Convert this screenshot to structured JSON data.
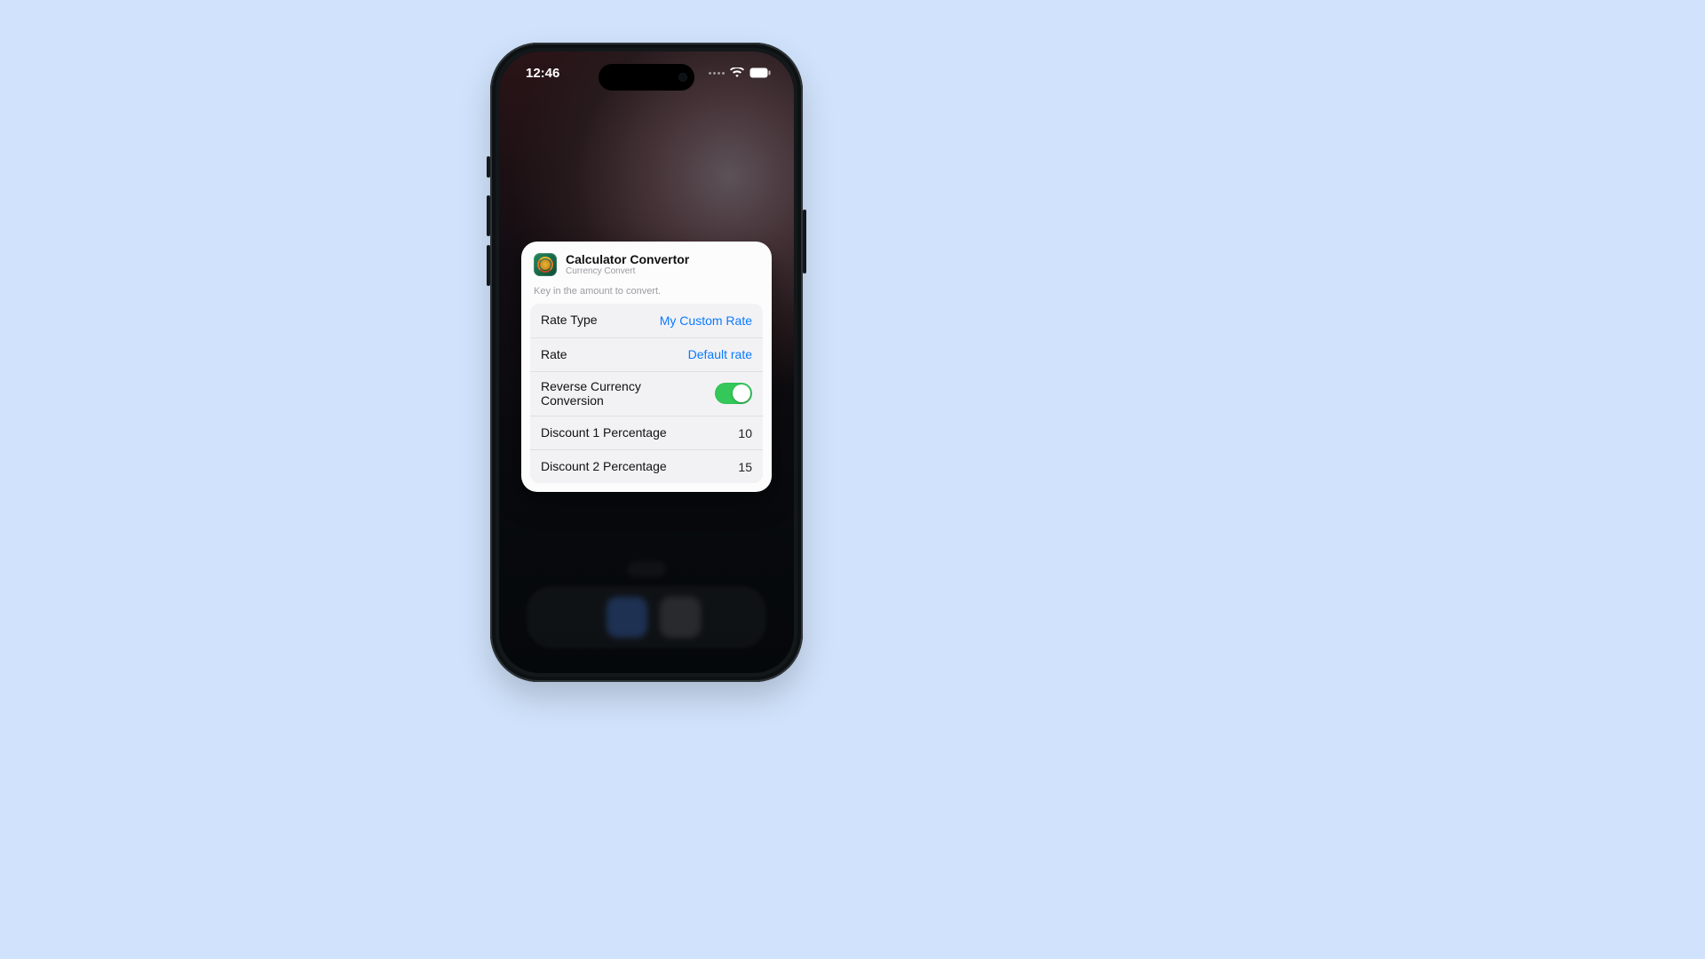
{
  "status_bar": {
    "time": "12:46"
  },
  "widget": {
    "title": "Calculator Convertor",
    "subtitle": "Currency Convert",
    "prompt": "Key in the amount to convert.",
    "rows": {
      "rate_type": {
        "label": "Rate Type",
        "value": "My Custom Rate"
      },
      "rate": {
        "label": "Rate",
        "value": "Default rate"
      },
      "reverse": {
        "label": "Reverse Currency Conversion",
        "on": true
      },
      "discount1": {
        "label": "Discount 1 Percentage",
        "value": "10"
      },
      "discount2": {
        "label": "Discount 2 Percentage",
        "value": "15"
      }
    }
  },
  "colors": {
    "link": "#0a7aff",
    "switch_on": "#34c759",
    "page_bg": "#d1e3fc"
  }
}
